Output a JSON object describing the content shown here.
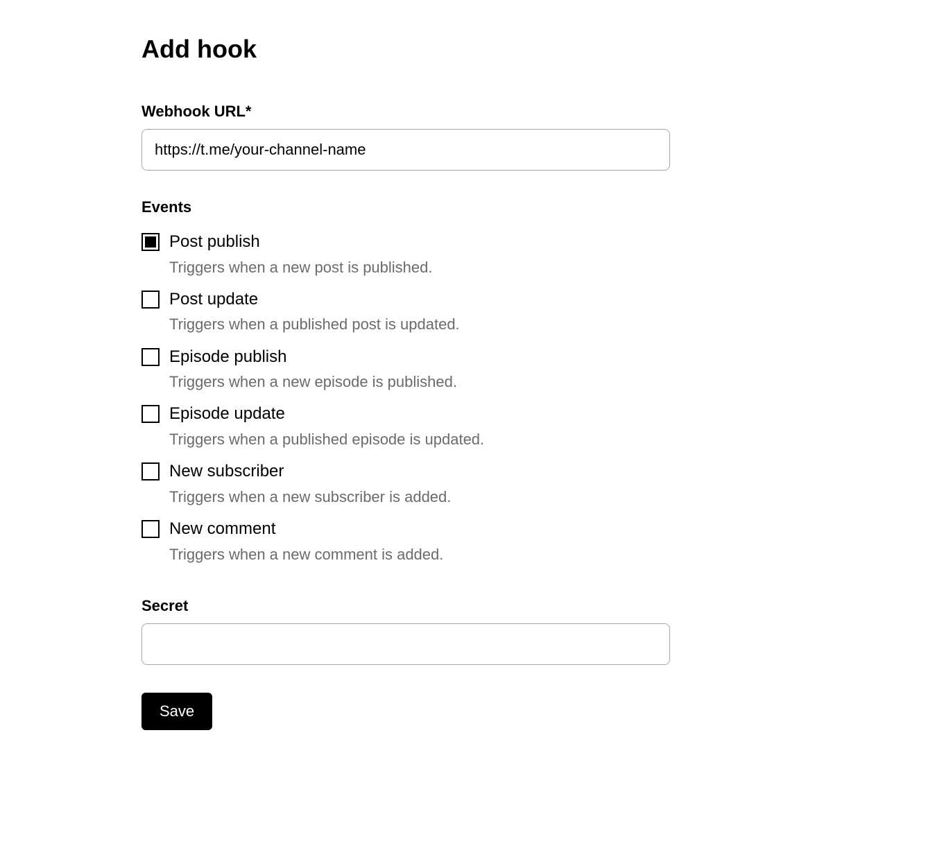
{
  "title": "Add hook",
  "webhook_url": {
    "label": "Webhook URL*",
    "value": "https://t.me/your-channel-name"
  },
  "events": {
    "label": "Events",
    "items": [
      {
        "name": "Post publish",
        "description": "Triggers when a new post is published.",
        "checked": true
      },
      {
        "name": "Post update",
        "description": "Triggers when a published post is updated.",
        "checked": false
      },
      {
        "name": "Episode publish",
        "description": "Triggers when a new episode is published.",
        "checked": false
      },
      {
        "name": "Episode update",
        "description": "Triggers when a published episode is updated.",
        "checked": false
      },
      {
        "name": "New subscriber",
        "description": "Triggers when a new subscriber is added.",
        "checked": false
      },
      {
        "name": "New comment",
        "description": "Triggers when a new comment is added.",
        "checked": false
      }
    ]
  },
  "secret": {
    "label": "Secret",
    "value": ""
  },
  "save_label": "Save"
}
